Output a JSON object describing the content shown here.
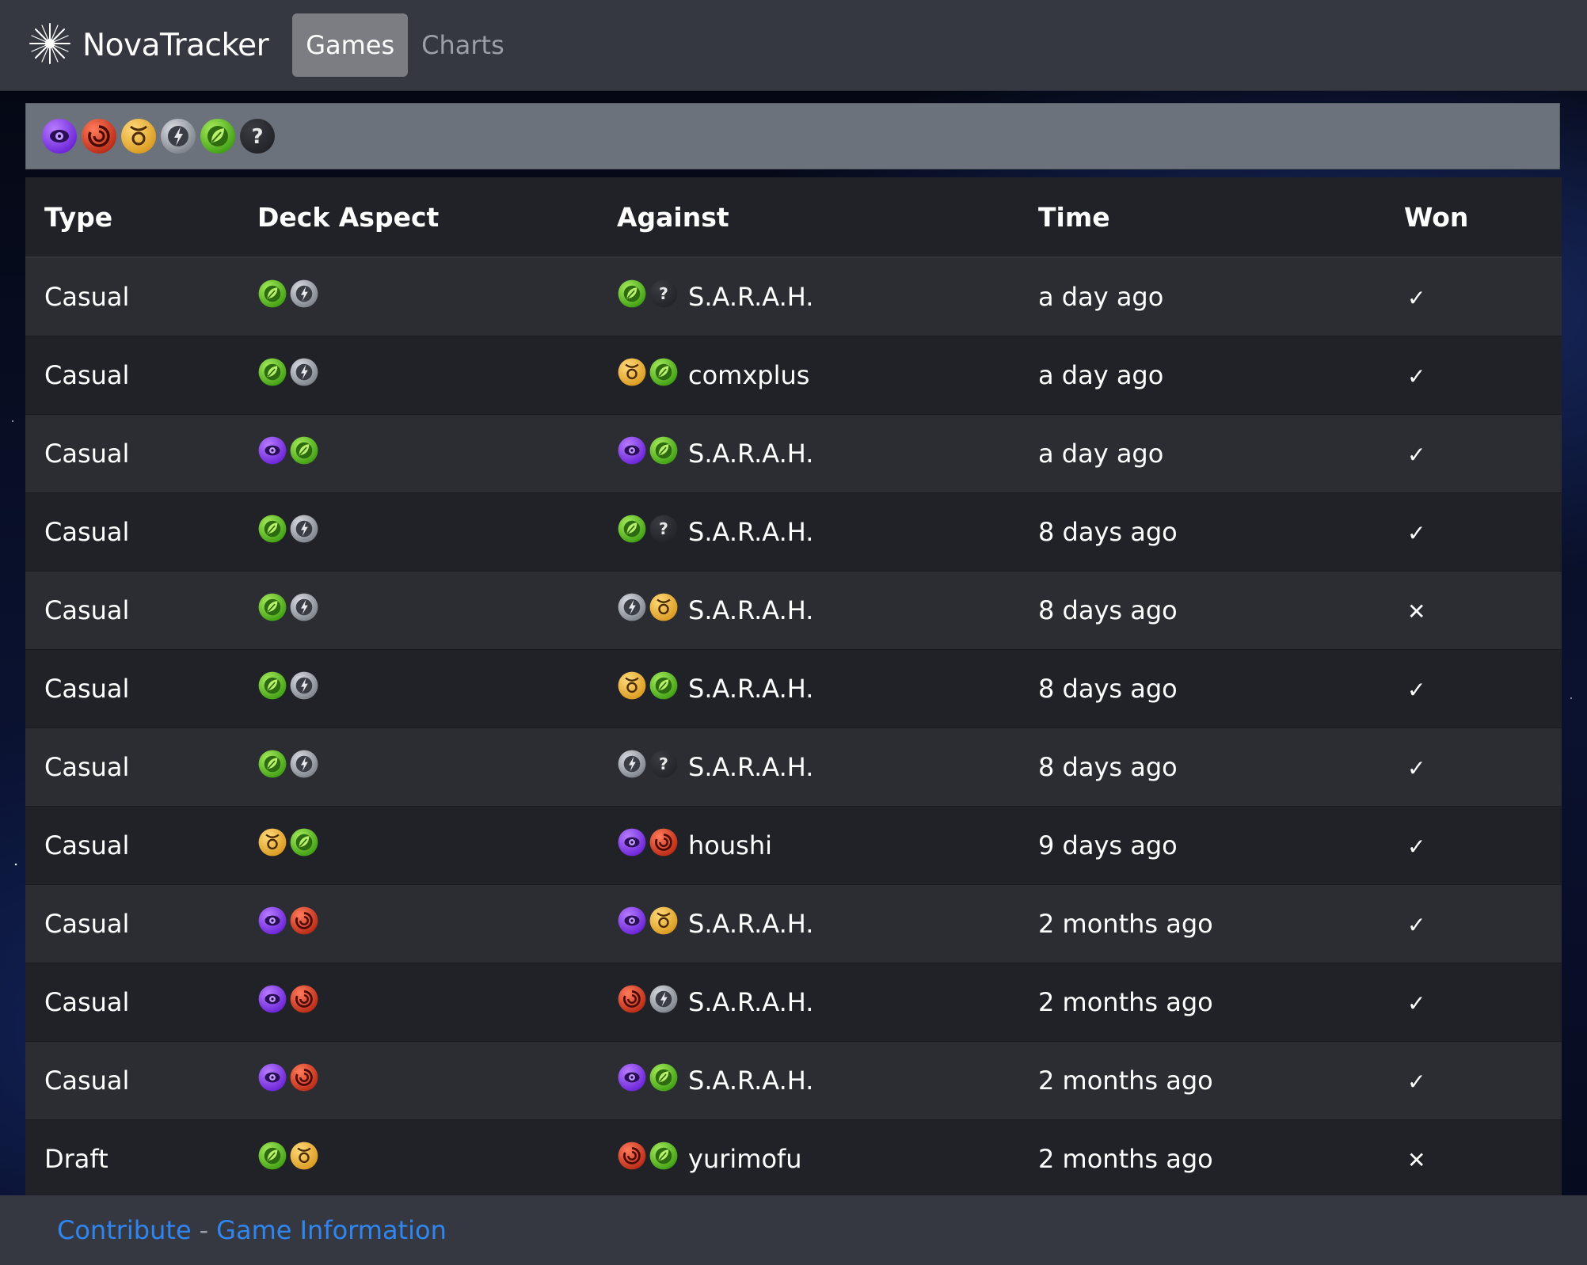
{
  "app": {
    "title": "NovaTracker",
    "logo_icon": "starburst-icon"
  },
  "nav": {
    "tabs": [
      {
        "label": "Games",
        "active": true
      },
      {
        "label": "Charts",
        "active": false
      }
    ]
  },
  "filter": {
    "aspects": [
      "mystic",
      "chaos",
      "strength",
      "technology",
      "nature",
      "unknown"
    ]
  },
  "colors": {
    "mystic": "#8a3ff0",
    "chaos": "#e0442a",
    "strength": "#f4b63b",
    "technology": "#9ea3ab",
    "nature": "#6fcf2a",
    "unknown": "#2b2d33",
    "link": "#2f86f0"
  },
  "table": {
    "headers": {
      "type": "Type",
      "deck": "Deck Aspect",
      "against": "Against",
      "time": "Time",
      "won": "Won"
    },
    "rows": [
      {
        "type": "Casual",
        "deck": [
          "nature",
          "technology"
        ],
        "against_aspects": [
          "nature",
          "unknown"
        ],
        "opponent": "S.A.R.A.H.",
        "time": "a day ago",
        "won": "✓"
      },
      {
        "type": "Casual",
        "deck": [
          "nature",
          "technology"
        ],
        "against_aspects": [
          "strength",
          "nature"
        ],
        "opponent": "comxplus",
        "time": "a day ago",
        "won": "✓"
      },
      {
        "type": "Casual",
        "deck": [
          "mystic",
          "nature"
        ],
        "against_aspects": [
          "mystic",
          "nature"
        ],
        "opponent": "S.A.R.A.H.",
        "time": "a day ago",
        "won": "✓"
      },
      {
        "type": "Casual",
        "deck": [
          "nature",
          "technology"
        ],
        "against_aspects": [
          "nature",
          "unknown"
        ],
        "opponent": "S.A.R.A.H.",
        "time": "8 days ago",
        "won": "✓"
      },
      {
        "type": "Casual",
        "deck": [
          "nature",
          "technology"
        ],
        "against_aspects": [
          "technology",
          "strength"
        ],
        "opponent": "S.A.R.A.H.",
        "time": "8 days ago",
        "won": "✕"
      },
      {
        "type": "Casual",
        "deck": [
          "nature",
          "technology"
        ],
        "against_aspects": [
          "strength",
          "nature"
        ],
        "opponent": "S.A.R.A.H.",
        "time": "8 days ago",
        "won": "✓"
      },
      {
        "type": "Casual",
        "deck": [
          "nature",
          "technology"
        ],
        "against_aspects": [
          "technology",
          "unknown"
        ],
        "opponent": "S.A.R.A.H.",
        "time": "8 days ago",
        "won": "✓"
      },
      {
        "type": "Casual",
        "deck": [
          "strength",
          "nature"
        ],
        "against_aspects": [
          "mystic",
          "chaos"
        ],
        "opponent": "houshi",
        "time": "9 days ago",
        "won": "✓"
      },
      {
        "type": "Casual",
        "deck": [
          "mystic",
          "chaos"
        ],
        "against_aspects": [
          "mystic",
          "strength"
        ],
        "opponent": "S.A.R.A.H.",
        "time": "2 months ago",
        "won": "✓"
      },
      {
        "type": "Casual",
        "deck": [
          "mystic",
          "chaos"
        ],
        "against_aspects": [
          "chaos",
          "technology"
        ],
        "opponent": "S.A.R.A.H.",
        "time": "2 months ago",
        "won": "✓"
      },
      {
        "type": "Casual",
        "deck": [
          "mystic",
          "chaos"
        ],
        "against_aspects": [
          "mystic",
          "nature"
        ],
        "opponent": "S.A.R.A.H.",
        "time": "2 months ago",
        "won": "✓"
      },
      {
        "type": "Draft",
        "deck": [
          "nature",
          "strength"
        ],
        "against_aspects": [
          "chaos",
          "nature"
        ],
        "opponent": "yurimofu",
        "time": "2 months ago",
        "won": "✕"
      }
    ]
  },
  "footer": {
    "contribute": "Contribute",
    "separator": "-",
    "game_info": "Game Information"
  }
}
